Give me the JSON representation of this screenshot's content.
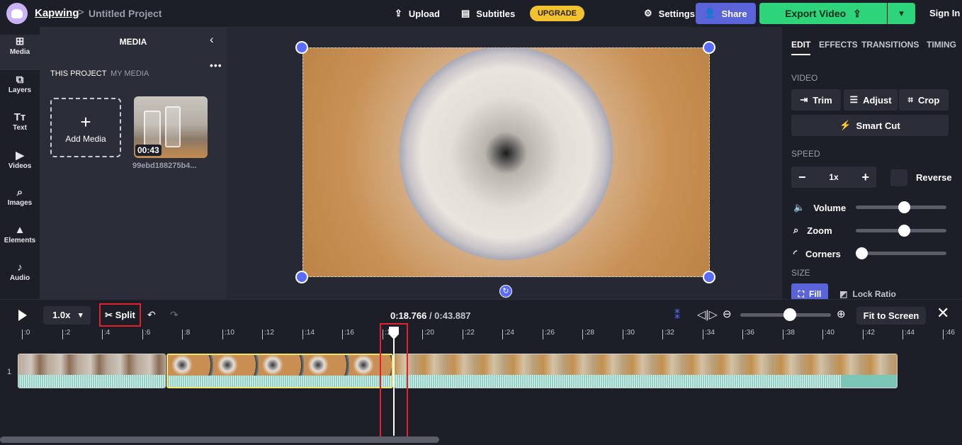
{
  "header": {
    "brand": "Kapwing",
    "separator": ">",
    "project_title": "Untitled Project",
    "upload_label": "Upload",
    "subtitles_label": "Subtitles",
    "upgrade_label": "UPGRADE",
    "settings_label": "Settings",
    "share_label": "Share",
    "export_label": "Export Video",
    "signin_label": "Sign In"
  },
  "toolrail": {
    "items": [
      {
        "label": "Media",
        "icon": "media-plus-icon"
      },
      {
        "label": "Layers",
        "icon": "layers-icon"
      },
      {
        "label": "Text",
        "icon": "text-icon"
      },
      {
        "label": "Videos",
        "icon": "video-icon"
      },
      {
        "label": "Images",
        "icon": "search-icon"
      },
      {
        "label": "Elements",
        "icon": "shapes-icon"
      },
      {
        "label": "Audio",
        "icon": "music-note-icon"
      }
    ]
  },
  "media_panel": {
    "title": "MEDIA",
    "tabs": [
      "THIS PROJECT",
      "MY MEDIA"
    ],
    "add_media_label": "Add Media",
    "item": {
      "duration": "00:43",
      "filename": "99ebd188275b4..."
    }
  },
  "right_panel": {
    "tabs": [
      "EDIT",
      "EFFECTS",
      "TRANSITIONS",
      "TIMING"
    ],
    "video_section": "VIDEO",
    "trim_label": "Trim",
    "adjust_label": "Adjust",
    "crop_label": "Crop",
    "smart_cut_label": "Smart Cut",
    "speed_section": "SPEED",
    "speed_value": "1x",
    "reverse_label": "Reverse",
    "volume_label": "Volume",
    "zoom_label": "Zoom",
    "corners_label": "Corners",
    "size_section": "SIZE",
    "fill_label": "Fill",
    "lock_ratio_label": "Lock Ratio",
    "sliders": {
      "volume": 0.5,
      "zoom": 0.5,
      "corners": 0.0
    }
  },
  "timeline": {
    "speed": "1.0x",
    "split_label": "Split",
    "current_time": "0:18.766",
    "time_sep": " / ",
    "total_time": "0:43.887",
    "fit_label": "Fit to Screen",
    "track_number": "1",
    "ruler": [
      ":0",
      ":2",
      ":4",
      ":6",
      ":8",
      ":10",
      ":12",
      ":14",
      ":16",
      ":18",
      ":20",
      ":22",
      ":24",
      ":26",
      ":28",
      ":30",
      ":32",
      ":34",
      ":36",
      ":38",
      ":40",
      ":42",
      ":44",
      ":46"
    ],
    "zoom_level": 0.5
  },
  "colors": {
    "accent": "#5a63d7",
    "export": "#2ed47a",
    "upgrade": "#f2c12e",
    "highlight": "#e3202b"
  }
}
